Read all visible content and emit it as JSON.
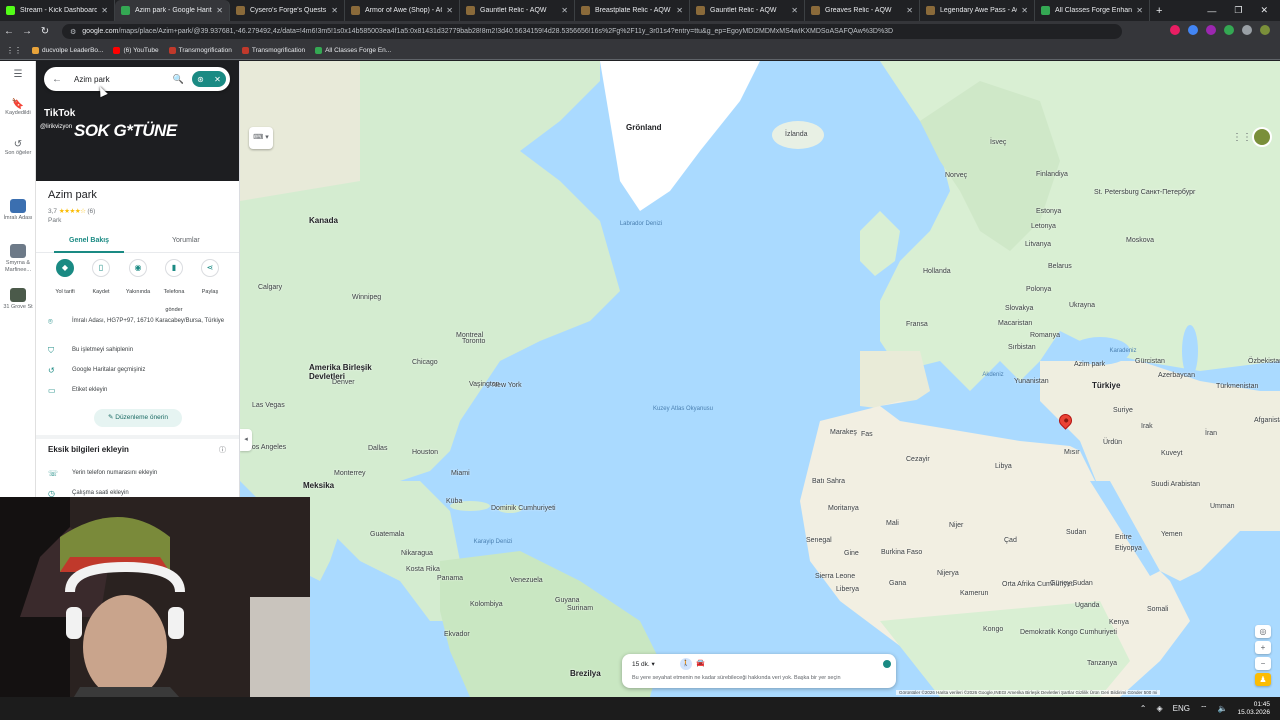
{
  "browser": {
    "tabs": [
      {
        "label": "Stream - Kick Dashboard",
        "color": "#53fc18",
        "active": false
      },
      {
        "label": "Azim park - Google Haritalar",
        "color": "#34a853",
        "active": true
      },
      {
        "label": "Cysero's Forge's Quests - AQ",
        "color": "#8a6a3a",
        "active": false
      },
      {
        "label": "Armor of Awe (Shop) - AQW",
        "color": "#8a6a3a",
        "active": false
      },
      {
        "label": "Gauntlet Relic - AQW",
        "color": "#8a6a3a",
        "active": false
      },
      {
        "label": "Breastplate Relic - AQW",
        "color": "#8a6a3a",
        "active": false
      },
      {
        "label": "Gauntlet Relic - AQW",
        "color": "#8a6a3a",
        "active": false
      },
      {
        "label": "Greaves Relic - AQW",
        "color": "#8a6a3a",
        "active": false
      },
      {
        "label": "Legendary Awe Pass - AQW",
        "color": "#8a6a3a",
        "active": false
      },
      {
        "label": "All Classes Forge Enhanceme",
        "color": "#34a853",
        "active": false
      }
    ],
    "url_host": "google.com",
    "url_path": "/maps/place/Azim+park/@39.937681,-46.279492,4z/data=!4m6!3m5!1s0x14b585003ea4f1a5:0x81431d32779bab28!8m2!3d40.5634159!4d28.5356656!16s%2Fg%2F11y_3r01s4?entry=ttu&g_ep=EgoyMDI2MDMxMS4wIKXMDSoASAFQAw%3D%3D",
    "bookmarks": [
      {
        "label": "ducvolpe LeaderBo...",
        "color": "#e8a33a"
      },
      {
        "label": "(6) YouTube",
        "color": "#ff0000"
      },
      {
        "label": "Transmogrification",
        "color": "#c0392b"
      },
      {
        "label": "Transmogrification",
        "color": "#c0392b"
      },
      {
        "label": "All Classes Forge En...",
        "color": "#34a853"
      }
    ]
  },
  "rail": {
    "saved": "Kaydedildi",
    "recent": "Son öğeler",
    "history": [
      {
        "label": "İmralı Adası"
      },
      {
        "label": "Smyrna & Marfinee..."
      },
      {
        "label": "31 Grove St"
      }
    ]
  },
  "search": {
    "query": "Azim park"
  },
  "hero": {
    "brand": "TikTok",
    "user": "@lirikvizyon",
    "caption": "SOK G*TÜNE"
  },
  "place": {
    "name": "Azim park",
    "rating": "3,7",
    "stars": "★★★★☆",
    "reviews": "(6)",
    "category": "Park",
    "tab_overview": "Genel Bakış",
    "tab_reviews": "Yorumlar",
    "actions": [
      {
        "label": "Yol tarifi",
        "icon": "directions-icon"
      },
      {
        "label": "Kaydet",
        "icon": "bookmark-icon"
      },
      {
        "label": "Yakınında",
        "icon": "nearby-icon"
      },
      {
        "label": "Telefona gönder",
        "icon": "phone-icon"
      },
      {
        "label": "Paylaş",
        "icon": "share-icon"
      }
    ],
    "address": "İmralı Adası, HG7P+97, 16710 Karacabey/Bursa, Türkiye",
    "claim": "Bu işletmeyi sahiplenin",
    "history": "Google Haritalar geçmişiniz",
    "label": "Etiket ekleyin",
    "suggest": "Düzenleme önerin",
    "missing_title": "Eksik bilgileri ekleyin",
    "missing_items": [
      "Yerin telefon numarasını ekleyin",
      "Çalışma saati ekleyin"
    ]
  },
  "map": {
    "labels": [
      {
        "t": "Grönland",
        "cls": "big"
      },
      {
        "t": "İzlanda",
        "cls": ""
      },
      {
        "t": "İsveç",
        "cls": ""
      },
      {
        "t": "Norveç",
        "cls": ""
      },
      {
        "t": "Finlandiya",
        "cls": ""
      },
      {
        "t": "St. Petersburg Санкт-Петербург",
        "cls": ""
      },
      {
        "t": "Estonya",
        "cls": ""
      },
      {
        "t": "Letonya",
        "cls": ""
      },
      {
        "t": "Litvanya",
        "cls": ""
      },
      {
        "t": "Moskova",
        "cls": ""
      },
      {
        "t": "Kanada",
        "cls": "big"
      },
      {
        "t": "Labrador Denizi",
        "cls": "sea"
      },
      {
        "t": "Hollanda",
        "cls": ""
      },
      {
        "t": "Belarus",
        "cls": ""
      },
      {
        "t": "Polonya",
        "cls": ""
      },
      {
        "t": "Ukrayna",
        "cls": ""
      },
      {
        "t": "Fransa",
        "cls": ""
      },
      {
        "t": "Slovakya",
        "cls": ""
      },
      {
        "t": "Macaristan",
        "cls": ""
      },
      {
        "t": "Romanya",
        "cls": ""
      },
      {
        "t": "Sırbistan",
        "cls": ""
      },
      {
        "t": "Yunanistan",
        "cls": ""
      },
      {
        "t": "Türkiye",
        "cls": "big"
      },
      {
        "t": "Gürcistan",
        "cls": ""
      },
      {
        "t": "Azerbaycan",
        "cls": ""
      },
      {
        "t": "Özbekistan",
        "cls": ""
      },
      {
        "t": "Türkmenistan",
        "cls": ""
      },
      {
        "t": "Suriye",
        "cls": ""
      },
      {
        "t": "Irak",
        "cls": ""
      },
      {
        "t": "İran",
        "cls": ""
      },
      {
        "t": "Afganistan",
        "cls": ""
      },
      {
        "t": "Ürdün",
        "cls": ""
      },
      {
        "t": "Kuveyt",
        "cls": ""
      },
      {
        "t": "Suudi Arabistan",
        "cls": ""
      },
      {
        "t": "Umman",
        "cls": ""
      },
      {
        "t": "Yemen",
        "cls": ""
      },
      {
        "t": "Mısır",
        "cls": ""
      },
      {
        "t": "Libya",
        "cls": ""
      },
      {
        "t": "Cezayir",
        "cls": ""
      },
      {
        "t": "Fas",
        "cls": ""
      },
      {
        "t": "Marakeş",
        "cls": ""
      },
      {
        "t": "Batı Sahra",
        "cls": ""
      },
      {
        "t": "Moritanya",
        "cls": ""
      },
      {
        "t": "Mali",
        "cls": ""
      },
      {
        "t": "Nijer",
        "cls": ""
      },
      {
        "t": "Çad",
        "cls": ""
      },
      {
        "t": "Sudan",
        "cls": ""
      },
      {
        "t": "Eritre",
        "cls": ""
      },
      {
        "t": "Etiyopya",
        "cls": ""
      },
      {
        "t": "Somali",
        "cls": ""
      },
      {
        "t": "Kenya",
        "cls": ""
      },
      {
        "t": "Senegal",
        "cls": ""
      },
      {
        "t": "Gine",
        "cls": ""
      },
      {
        "t": "Burkina Faso",
        "cls": ""
      },
      {
        "t": "Sierra Leone",
        "cls": ""
      },
      {
        "t": "Liberya",
        "cls": ""
      },
      {
        "t": "Gana",
        "cls": ""
      },
      {
        "t": "Nijerya",
        "cls": ""
      },
      {
        "t": "Kamerun",
        "cls": ""
      },
      {
        "t": "Orta Afrika Cumhuriyeti",
        "cls": ""
      },
      {
        "t": "Güney Sudan",
        "cls": ""
      },
      {
        "t": "Uganda",
        "cls": ""
      },
      {
        "t": "Kongo",
        "cls": ""
      },
      {
        "t": "Demokratik Kongo Cumhuriyeti",
        "cls": ""
      },
      {
        "t": "Tanzanya",
        "cls": ""
      },
      {
        "t": "Amerika Birleşik Devletleri",
        "cls": "big"
      },
      {
        "t": "Calgary",
        "cls": ""
      },
      {
        "t": "Winnipeg",
        "cls": ""
      },
      {
        "t": "Montreal",
        "cls": ""
      },
      {
        "t": "Toronto",
        "cls": ""
      },
      {
        "t": "Chicago",
        "cls": ""
      },
      {
        "t": "New York",
        "cls": ""
      },
      {
        "t": "Vaşington",
        "cls": ""
      },
      {
        "t": "Denver",
        "cls": ""
      },
      {
        "t": "Las Vegas",
        "cls": ""
      },
      {
        "t": "Los Angeles",
        "cls": ""
      },
      {
        "t": "Dallas",
        "cls": ""
      },
      {
        "t": "Houston",
        "cls": ""
      },
      {
        "t": "Monterrey",
        "cls": ""
      },
      {
        "t": "Miami",
        "cls": ""
      },
      {
        "t": "Meksika",
        "cls": "big"
      },
      {
        "t": "Küba",
        "cls": ""
      },
      {
        "t": "Dominik Cumhuriyeti",
        "cls": ""
      },
      {
        "t": "Guatemala",
        "cls": ""
      },
      {
        "t": "Nikaragua",
        "cls": ""
      },
      {
        "t": "Kosta Rika",
        "cls": ""
      },
      {
        "t": "Panama",
        "cls": ""
      },
      {
        "t": "Karayip Denizi",
        "cls": "sea"
      },
      {
        "t": "Venezuela",
        "cls": ""
      },
      {
        "t": "Kolombiya",
        "cls": ""
      },
      {
        "t": "Guyana",
        "cls": ""
      },
      {
        "t": "Surinam",
        "cls": ""
      },
      {
        "t": "Ekvador",
        "cls": ""
      },
      {
        "t": "Brezilya",
        "cls": "big"
      },
      {
        "t": "Kuzey Atlas Okyanusu",
        "cls": "sea"
      },
      {
        "t": "Akdeniz",
        "cls": "sea"
      },
      {
        "t": "Karadeniz",
        "cls": "sea"
      },
      {
        "t": "Azim park",
        "cls": ""
      }
    ],
    "travel": {
      "time": "15 dk.",
      "message": "Bu yere seyahat etmenin ne kadar sürebileceği hakkında veri yok. Başka bir yer seçin"
    },
    "attribution": "Görüntüler ©2026 Harita verileri ©2026 Google,INEGI   Amerika Birleşik Devletleri   Şartlar   Gizlilik   Ürün Geri Bildirimi Gönder   500 mi"
  },
  "taskbar": {
    "lang": "ENG",
    "time": "01:45",
    "date": "15.03.2026"
  }
}
